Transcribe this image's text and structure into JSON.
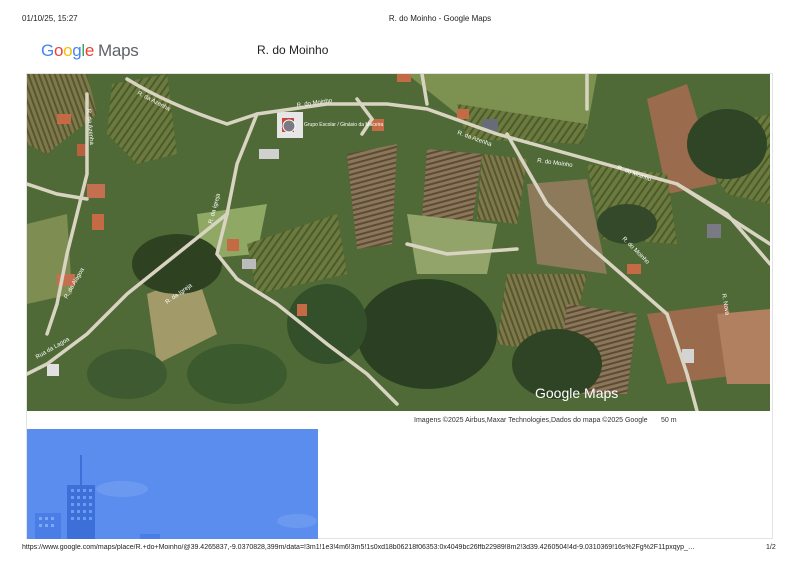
{
  "print_header": {
    "datetime": "01/10/25, 15:27",
    "doc_title": "R. do Moinho - Google Maps"
  },
  "logo": {
    "google": "Google",
    "maps": "Maps"
  },
  "place": {
    "name": "R. do Moinho"
  },
  "map": {
    "watermark": "Google Maps",
    "street_labels": [
      "R. da Azenha",
      "R. do Moinho",
      "R. do Moinho",
      "R. da Azenha",
      "R. da Azenha",
      "R. do Moinho",
      "R. da Alagoa",
      "Rua da Lagoa",
      "R. da Igreja",
      "R. da Igreja",
      "R. do Moinho",
      "R. Nova"
    ],
    "poi_label": "Grupo Escolar / Ginásio da Maceira"
  },
  "attribution": "Imagens ©2025 Airbus,Maxar Technologies,Dados do mapa ©2025 Google",
  "scale": "50 m",
  "print_footer": {
    "url": "https://www.google.com/maps/place/R.+do+Moinho/@39.4265837,-9.0370828,399m/data=!3m1!1e3!4m6!3m5!1s0xd18b06218f06353:0x4049bc26ffb22989!8m2!3d39.4260504!4d-9.0310369!16s%2Fg%2F11pxqyp_…",
    "page": "1/2"
  },
  "colors": {
    "google_blue": "#4285f4",
    "google_red": "#ea4335",
    "google_yellow": "#fbbc05",
    "google_green": "#34a853",
    "streetview_bg": "#5b8dee"
  }
}
